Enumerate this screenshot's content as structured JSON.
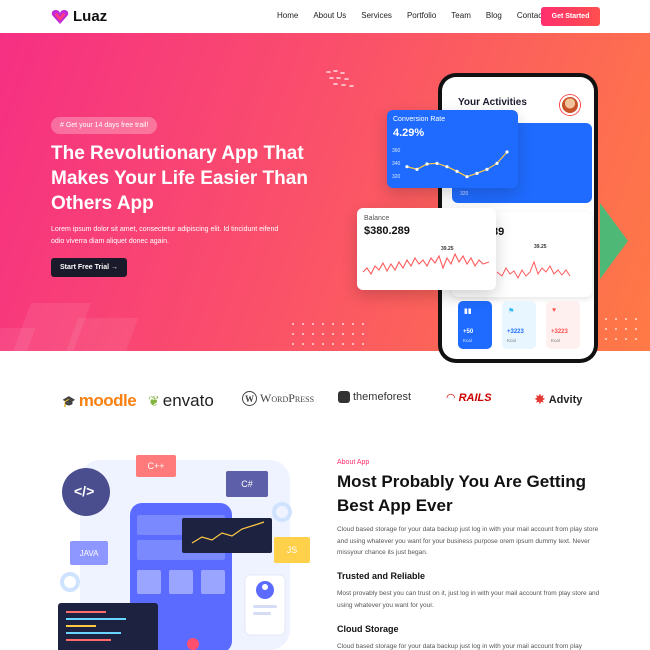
{
  "brand": {
    "name": "Luaz"
  },
  "nav": {
    "items": [
      "Home",
      "About Us",
      "Services",
      "Portfolio",
      "Team",
      "Blog",
      "Contact Us"
    ],
    "cta": "Get Started"
  },
  "hero": {
    "badge": "# Get your 14 days free trail!",
    "title": "The Revolutionary App That Makes Your Life Easier Than Others App",
    "description": "Lorem ipsum dolor sit amet, consectetur adipiscing elit. Id tincidunt eifend odio viverra diam aliquet donec again.",
    "button": "Start Free Trial →"
  },
  "phone": {
    "activities_title": "Your Activities",
    "conversion": {
      "label": "Conversion Rate",
      "value": "4.29%",
      "axis_ticks": [
        "360",
        "340",
        "320"
      ],
      "line_points": [
        340,
        336,
        344,
        345,
        340,
        333,
        325,
        330,
        336,
        345,
        362
      ]
    },
    "balance": {
      "label": "Balance",
      "value": "$380.289",
      "peak_label": "39.25",
      "secondary_value_fragment": "89",
      "secondary_peak_label": "39.25"
    },
    "bottom_tiles": [
      {
        "value": "+50",
        "unit": "Kcal",
        "color": "#1f6bff"
      },
      {
        "value": "+3223",
        "unit": "Kcal",
        "color": "#e8f6ff"
      },
      {
        "value": "+3223",
        "unit": "Kcal",
        "color": "#fff0f0"
      }
    ],
    "axis_fragment": "320"
  },
  "brands": [
    "moodle",
    "envato",
    "WordPress",
    "themeforest",
    "RAILS",
    "Advity"
  ],
  "about": {
    "tag": "About App",
    "title": "Most Probably You Are Getting Best App Ever",
    "paragraph1": "Cloud based storage for your data backup just log in with your mail account from play store and using whatever you want for your business purpose orem ipsum dummy text. Never missyour chance its just began.",
    "sub1": "Trusted and Reliable",
    "paragraph2": "Most provably best you can trust on it, just log in with your mail account from play store and using whatever you want for your.",
    "sub2": "Cloud Storage",
    "paragraph3": "Cloud based storage for your data backup just log in with your mail account from play"
  },
  "illustration": {
    "tags": [
      "C++",
      "C#",
      "JAVA",
      "JS"
    ],
    "code_icon": "</>"
  },
  "colors": {
    "accent": "#ff2e6e",
    "hero_start": "#f62f83",
    "hero_end": "#ff7a45",
    "blue": "#1f6bff"
  }
}
